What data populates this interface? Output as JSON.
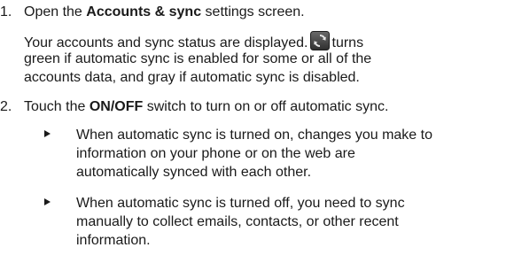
{
  "steps": [
    {
      "number": "1.",
      "prefix": "Open the ",
      "bold": "Accounts & sync",
      "suffix": " settings screen."
    },
    {
      "number": "2.",
      "prefix": "Touch the ",
      "bold": "ON/OFF",
      "suffix": " switch to turn on or off automatic sync."
    }
  ],
  "note": {
    "line1_before_icon": "Your accounts and sync status are displayed.",
    "line1_after_icon": "turns",
    "line2": "green if automatic sync is enabled for some or all of the",
    "line3": "accounts data, and gray if automatic sync is disabled.",
    "icon": "sync-icon"
  },
  "bullets": [
    {
      "lines": [
        "When automatic sync is turned on, changes you make to",
        "information on your phone or on the web are",
        "automatically synced with each other."
      ]
    },
    {
      "lines": [
        "When automatic sync is turned off, you need to sync",
        "manually to collect emails, contacts, or other recent",
        "information."
      ]
    }
  ]
}
